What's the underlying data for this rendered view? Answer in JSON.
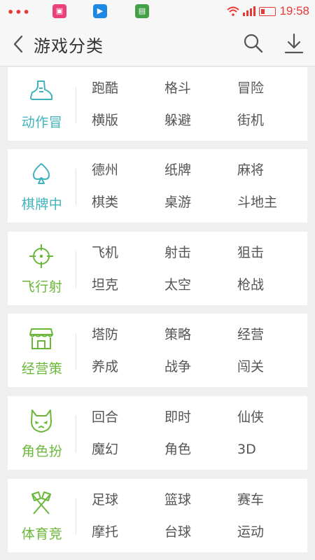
{
  "status_bar": {
    "time": "19:58",
    "notification_dots": "•••",
    "accent_color": "#e53935"
  },
  "header": {
    "title": "游戏分类",
    "back_icon": "chevron-left-icon",
    "search_icon": "search-icon",
    "download_icon": "download-icon"
  },
  "categories": [
    {
      "label": "动作冒",
      "icon": "shoe-icon",
      "color": "#3fb3bd",
      "tags": [
        "跑酷",
        "格斗",
        "冒险",
        "横版",
        "躲避",
        "街机"
      ]
    },
    {
      "label": "棋牌中",
      "icon": "spade-icon",
      "color": "#3fb3bd",
      "tags": [
        "德州",
        "纸牌",
        "麻将",
        "棋类",
        "桌游",
        "斗地主"
      ]
    },
    {
      "label": "飞行射",
      "icon": "crosshair-icon",
      "color": "#6ab73a",
      "tags": [
        "飞机",
        "射击",
        "狙击",
        "坦克",
        "太空",
        "枪战"
      ]
    },
    {
      "label": "经营策",
      "icon": "shop-icon",
      "color": "#6ab73a",
      "tags": [
        "塔防",
        "策略",
        "经营",
        "养成",
        "战争",
        "闯关"
      ]
    },
    {
      "label": "角色扮",
      "icon": "mask-icon",
      "color": "#6ab73a",
      "tags": [
        "回合",
        "即时",
        "仙侠",
        "魔幻",
        "角色",
        "3D"
      ]
    },
    {
      "label": "体育竞",
      "icon": "crossed-flags-icon",
      "color": "#6ab73a",
      "tags": [
        "足球",
        "篮球",
        "赛车",
        "摩托",
        "台球",
        "运动"
      ]
    }
  ]
}
